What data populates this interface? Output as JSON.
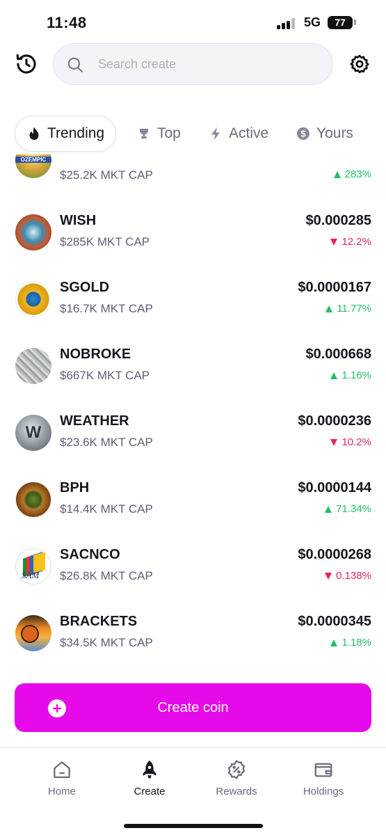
{
  "status_bar": {
    "time": "11:48",
    "network": "5G",
    "battery": "77"
  },
  "search": {
    "placeholder": "Search create"
  },
  "tabs": [
    {
      "label": "Trending",
      "icon": "flame-icon",
      "active": true
    },
    {
      "label": "Top",
      "icon": "trophy-icon",
      "active": false
    },
    {
      "label": "Active",
      "icon": "bolt-icon",
      "active": false
    },
    {
      "label": "Yours",
      "icon": "coin-icon",
      "active": false
    }
  ],
  "coins": [
    {
      "name": "",
      "cap": "$25.2K MKT CAP",
      "price": "",
      "change": "283%",
      "direction": "up",
      "avatar_label": "OZEMPIC"
    },
    {
      "name": "WISH",
      "cap": "$285K MKT CAP",
      "price": "$0.000285",
      "change": "12.2%",
      "direction": "down"
    },
    {
      "name": "SGOLD",
      "cap": "$16.7K MKT CAP",
      "price": "$0.0000167",
      "change": "11.77%",
      "direction": "up"
    },
    {
      "name": "NOBROKE",
      "cap": "$667K MKT CAP",
      "price": "$0.000668",
      "change": "1.16%",
      "direction": "up"
    },
    {
      "name": "WEATHER",
      "cap": "$23.6K MKT CAP",
      "price": "$0.0000236",
      "change": "10.2%",
      "direction": "down"
    },
    {
      "name": "BPH",
      "cap": "$14.4K MKT CAP",
      "price": "$0.0000144",
      "change": "71.34%",
      "direction": "up"
    },
    {
      "name": "SACNCO",
      "cap": "$26.8K MKT CAP",
      "price": "$0.0000268",
      "change": "0.138%",
      "direction": "down",
      "avatar_label": "SAM"
    },
    {
      "name": "BRACKETS",
      "cap": "$34.5K MKT CAP",
      "price": "$0.0000345",
      "change": "1.18%",
      "direction": "up"
    }
  ],
  "create_button": {
    "label": "Create coin"
  },
  "nav": [
    {
      "label": "Home",
      "icon": "home-icon",
      "active": false
    },
    {
      "label": "Create",
      "icon": "rocket-icon",
      "active": true
    },
    {
      "label": "Rewards",
      "icon": "percent-badge-icon",
      "active": false
    },
    {
      "label": "Holdings",
      "icon": "wallet-icon",
      "active": false
    }
  ],
  "colors": {
    "accent": "#e60aea",
    "up": "#1fbf67",
    "down": "#e5245f",
    "muted": "#6b6b7b"
  }
}
